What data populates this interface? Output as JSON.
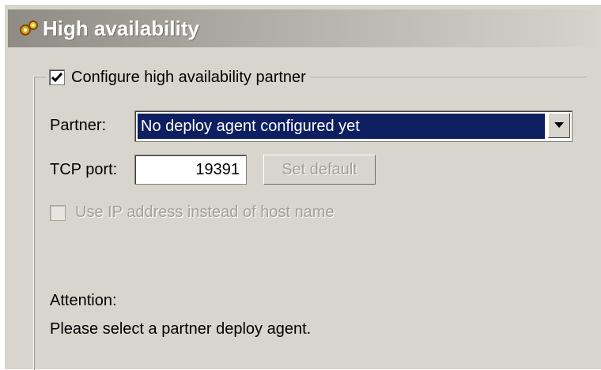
{
  "header": {
    "title": "High availability",
    "icon": "gears-icon"
  },
  "config": {
    "checkbox_label": "Configure high availability partner",
    "checked": true,
    "partner_label": "Partner:",
    "partner_value": "No deploy agent configured yet",
    "tcp_label": "TCP port:",
    "tcp_value": "19391",
    "set_default_label": "Set default",
    "use_ip_label": "Use IP address instead of host name",
    "use_ip_checked": false
  },
  "attention": {
    "title": "Attention:",
    "message": "Please select a partner deploy agent."
  },
  "colors": {
    "selection_bg": "#0d1f61",
    "panel_bg": "#d8d5cc",
    "disabled_text": "#a29f97"
  }
}
